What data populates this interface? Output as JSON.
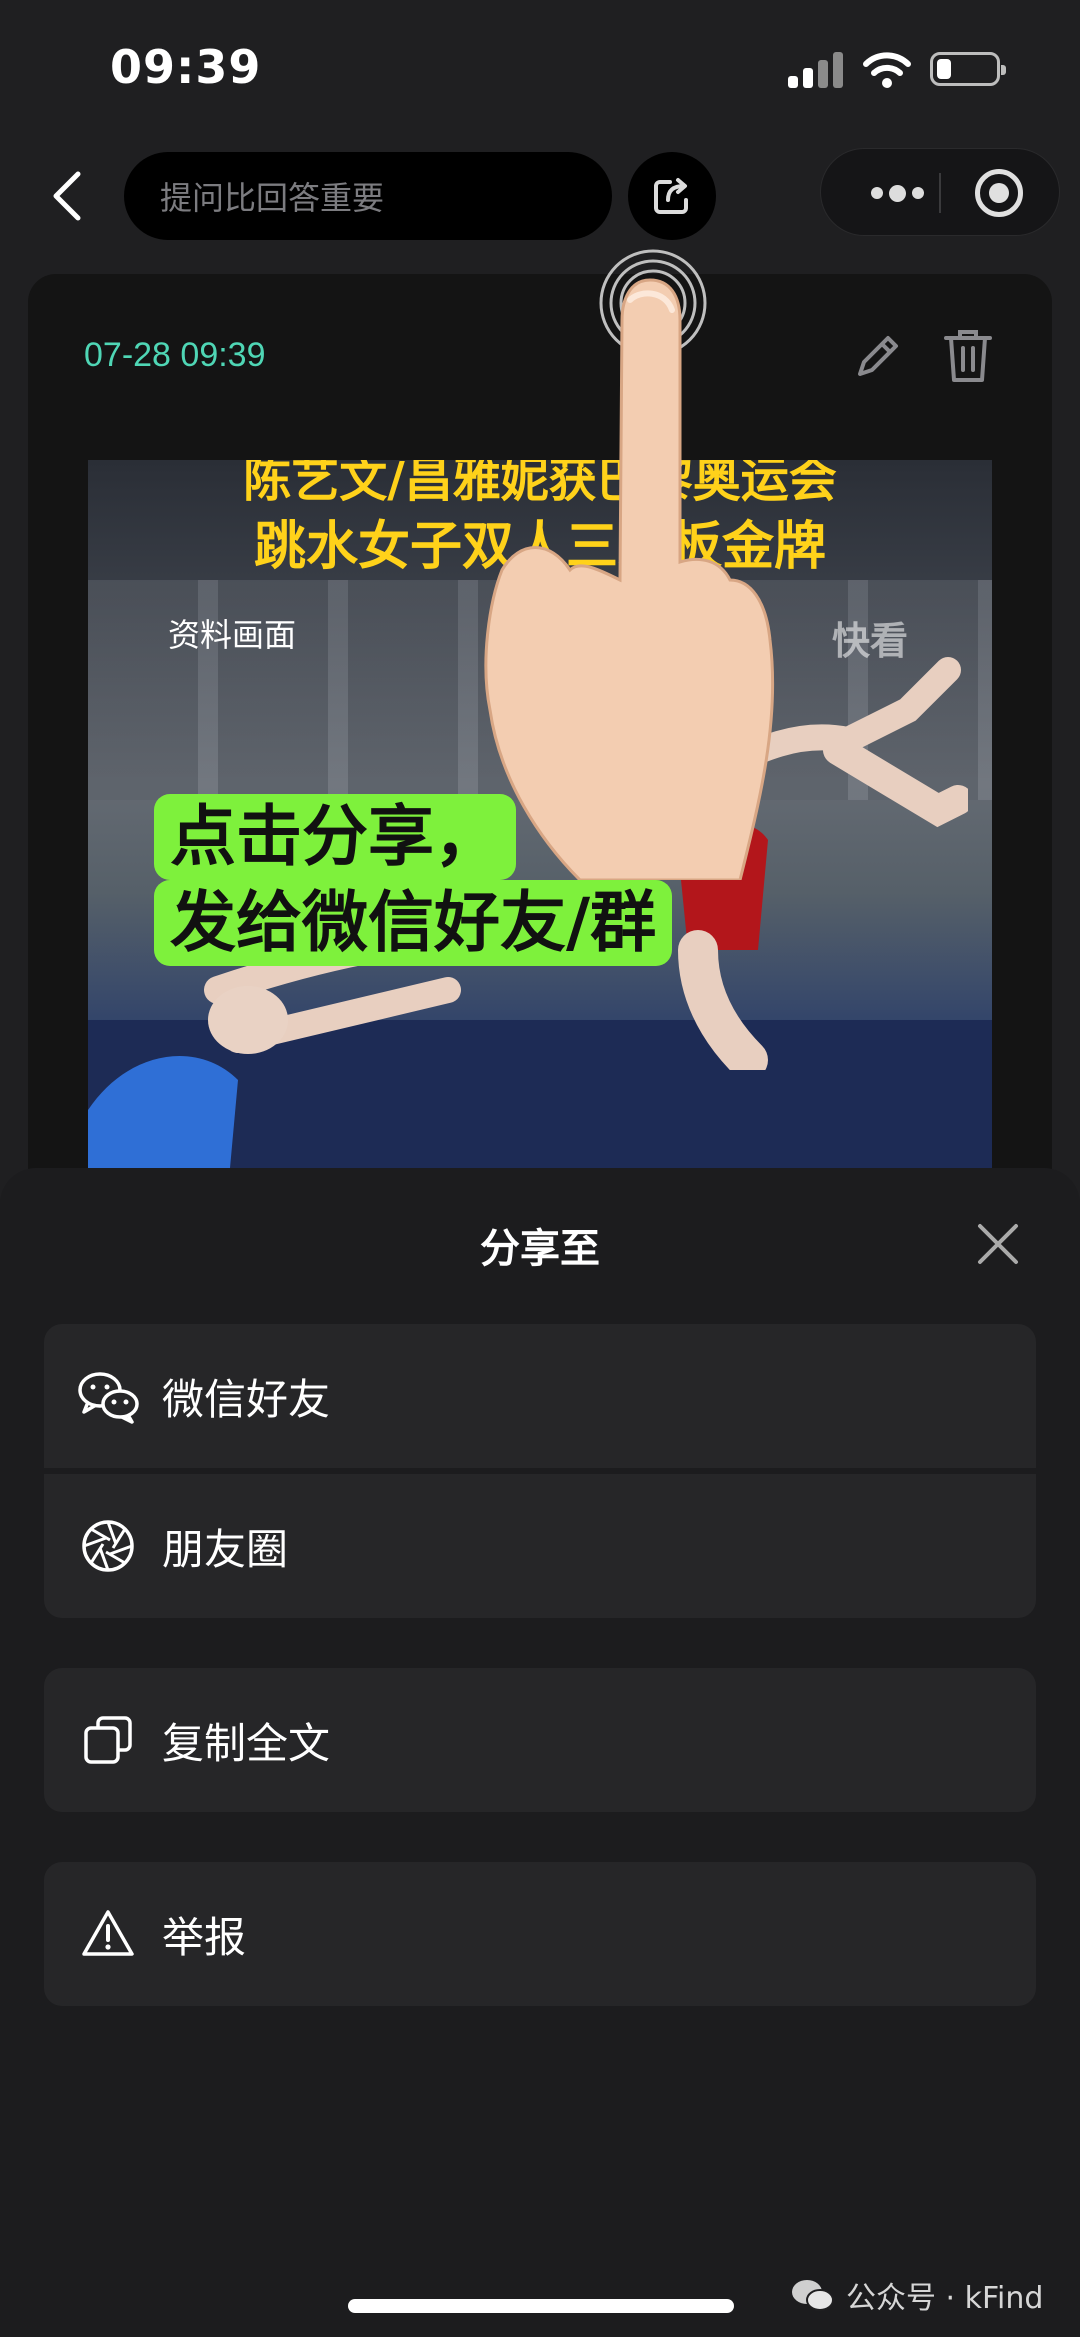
{
  "status_bar": {
    "time": "09:39"
  },
  "nav": {
    "search_placeholder": "提问比回答重要"
  },
  "card": {
    "date": "07-28 09:39",
    "media": {
      "title_line1": "陈艺文/昌雅妮获巴黎奥运会",
      "title_line2": "跳水女子双人三米板金牌",
      "caption": "资料画面",
      "watermark": "快看"
    },
    "hint_line1": "点击分享，",
    "hint_line2": "发给微信好友/群"
  },
  "sheet": {
    "title": "分享至",
    "options": [
      {
        "label": "微信好友",
        "icon": "wechat-icon"
      },
      {
        "label": "朋友圈",
        "icon": "moments-icon"
      },
      {
        "label": "复制全文",
        "icon": "copy-icon"
      },
      {
        "label": "举报",
        "icon": "warning-icon"
      }
    ]
  },
  "footer": {
    "watermark": "公众号 · kFind"
  },
  "colors": {
    "accent_date": "#4fd6b5",
    "hint_bg": "#7ef13c",
    "media_title": "#ffd21a",
    "sheet_bg": "#1c1c1e",
    "option_bg": "#262628"
  }
}
